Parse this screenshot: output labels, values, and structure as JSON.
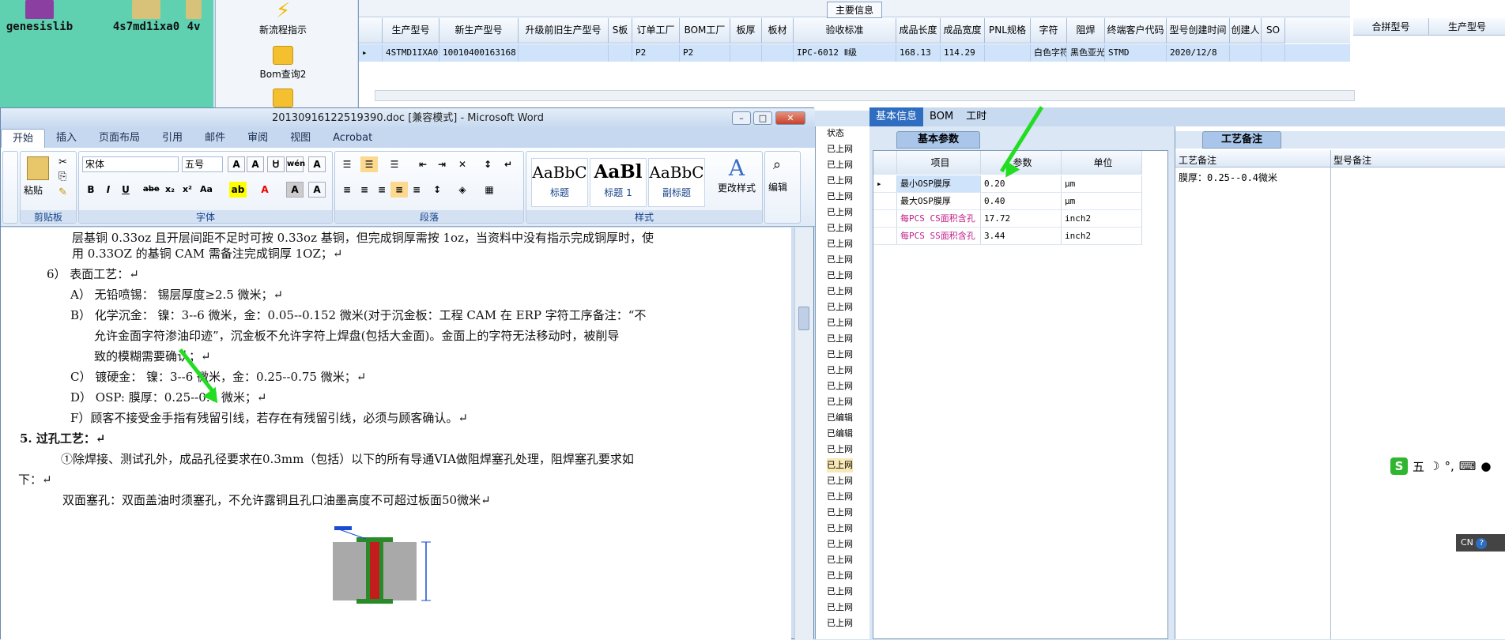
{
  "desktop": {
    "icons": [
      "genesislib",
      "4s7md1ixa0",
      "4v"
    ]
  },
  "launcher": {
    "items": [
      "新流程指示",
      "Bom查询2"
    ]
  },
  "top_grid": {
    "caption": "主要信息",
    "columns": [
      "生产型号",
      "新生产型号",
      "升级前旧生产型号",
      "S板",
      "订单工厂",
      "BOM工厂",
      "板厚",
      "板材",
      "验收标准",
      "成品长度",
      "成品宽度",
      "PNL规格",
      "字符",
      "阻焊",
      "终端客户代码",
      "型号创建时间",
      "创建人",
      "SO"
    ],
    "row": [
      "4STMD1IXA0",
      "10010400163168",
      "",
      "",
      "P2",
      "P2",
      "",
      "",
      "IPC-6012 Ⅱ级",
      "168.13",
      "114.29",
      "",
      "白色字符",
      "黑色亚光",
      "STMD",
      "2020/12/8",
      "",
      ""
    ],
    "right_columns": [
      "合拼型号",
      "生产型号"
    ]
  },
  "word": {
    "title": "20130916122519390.doc [兼容模式] - Microsoft Word",
    "tabs": [
      "开始",
      "插入",
      "页面布局",
      "引用",
      "邮件",
      "审阅",
      "视图",
      "Acrobat"
    ],
    "font_name": "宋体",
    "font_size": "五号",
    "group_labels": [
      "剪贴板",
      "字体",
      "段落",
      "样式",
      "编辑"
    ],
    "paste_label": "粘贴",
    "styles": [
      {
        "sample": "AaBbC",
        "name": "标题"
      },
      {
        "sample": "AaBl",
        "name": "标题 1"
      },
      {
        "sample": "AaBbC",
        "name": "副标题"
      }
    ],
    "change_styles": "更改样式",
    "edit_label": "编辑",
    "doc_lines": [
      "层基铜 0.33oz 且开层间距不足时可按 0.33oz 基铜，但完成铜厚需按 1oz，当资料中没有指示完成铜厚时，使",
      "用 0.33OZ 的基铜 CAM 需备注完成铜厚 1OZ；↵",
      "6） 表面工艺：↵",
      "A） 无铅喷锡：  锡层厚度≥2.5 微米；↵",
      "B） 化学沉金：  镍：3--6 微米，金：0.05--0.152 微米(对于沉金板：工程 CAM 在 ERP 字符工序备注：“不",
      "允许金面字符渗油印迹”，沉金板不允许字符上焊盘(包括大金面)。金面上的字符无法移动时，被削导",
      "致的模糊需要确认；↵",
      "C） 镀硬金：     镍：3--6 微米，金：0.25--0.75 微米；↵",
      "D） OSP:         膜厚：0.25--0.4 微米；↵",
      "F）顾客不接受金手指有残留引线，若存在有残留引线，必须与顾客确认。↵",
      "5.   过孔工艺：↵",
      "①除焊接、测试孔外，成品孔径要求在0.3mm（包括）以下的所有导通VIA做阻焊塞孔处理，阻焊塞孔要求如",
      "下：↵",
      "双面塞孔：双面盖油时须塞孔，不允许露铜且孔口油墨高度不可超过板面50微米↵"
    ]
  },
  "status_col": {
    "header": "状态",
    "items": [
      "已上网",
      "已上网",
      "已上网",
      "已上网",
      "已上网",
      "已上网",
      "已上网",
      "已上网",
      "已上网",
      "已上网",
      "已上网",
      "已上网",
      "已上网",
      "已上网",
      "已上网",
      "已上网",
      "已上网",
      "已编辑",
      "已编辑",
      "已上网",
      "已上网",
      "已上网",
      "已上网",
      "已上网",
      "已上网",
      "已上网",
      "已上网",
      "已上网",
      "已上网",
      "已上网",
      "已上网"
    ]
  },
  "right_panel": {
    "tabs": [
      "基本信息",
      "BOM",
      "工时"
    ],
    "subtab": "基本参数",
    "param_headers": [
      "项目",
      "参数",
      "单位"
    ],
    "params": [
      {
        "name": "最小OSP膜厚",
        "value": "0.20",
        "unit": "μm"
      },
      {
        "name": "最大OSP膜厚",
        "value": "0.40",
        "unit": "μm"
      },
      {
        "name": "每PCS CS面积含孔",
        "value": "17.72",
        "unit": "inch2"
      },
      {
        "name": "每PCS SS面积含孔",
        "value": "3.44",
        "unit": "inch2"
      }
    ],
    "remark_tab": "工艺备注",
    "remark_headers": [
      "工艺备注",
      "型号备注"
    ],
    "remark_text": "膜厚：0.25--0.4微米"
  },
  "ime": {
    "lang": "五",
    "cn": "CN"
  },
  "colors": {
    "accent": "#2e6dc0",
    "selected_row": "#cfe3fb",
    "arrow": "#22dd22"
  }
}
